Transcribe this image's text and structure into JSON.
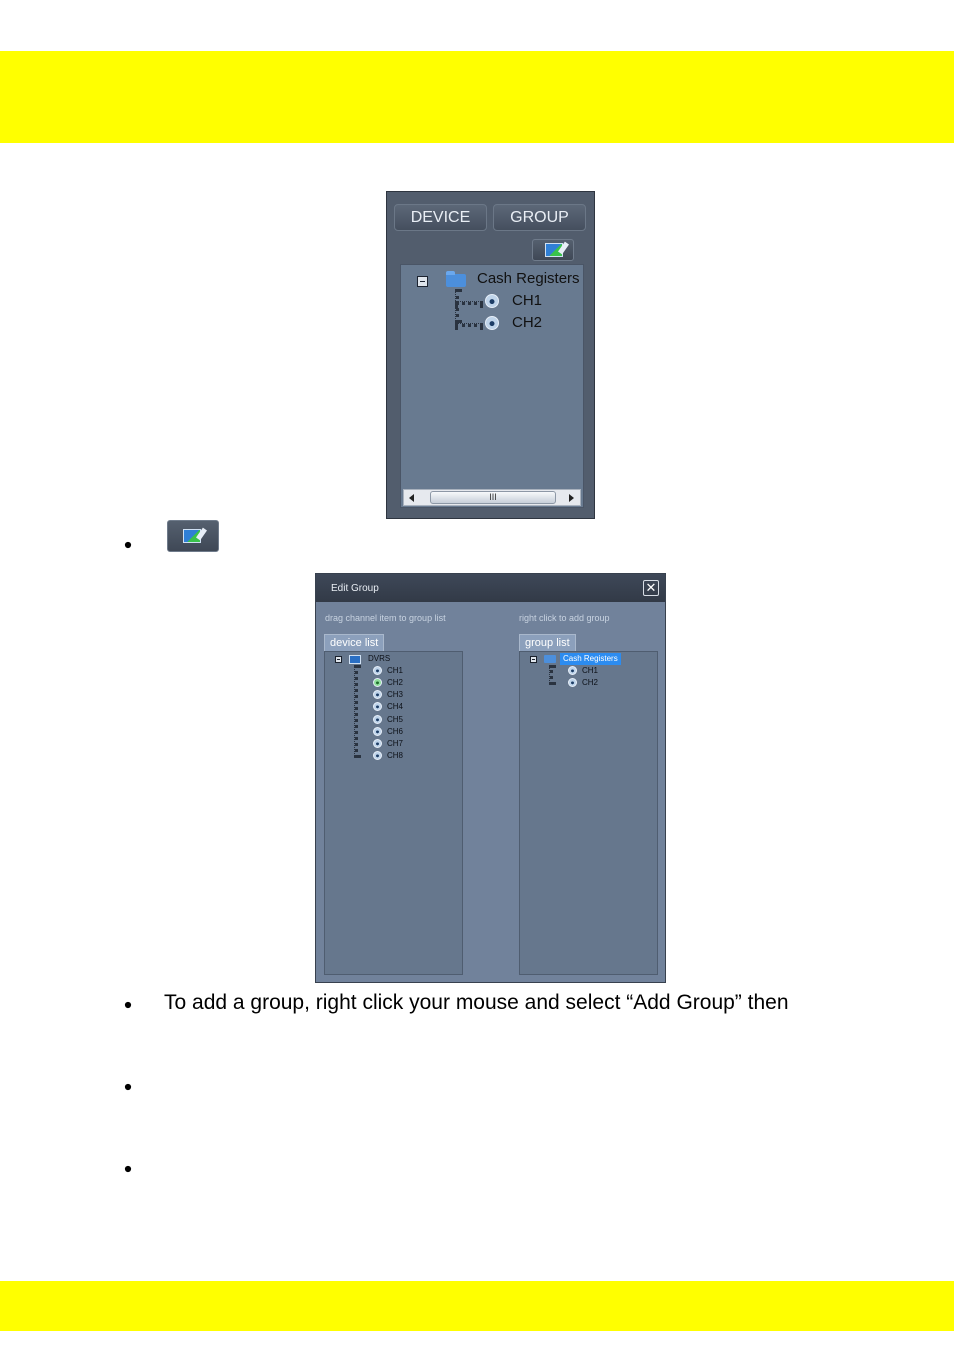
{
  "panel1": {
    "tabs": [
      "DEVICE",
      "GROUP"
    ],
    "edit_button_icon": "edit-group-icon",
    "tree": {
      "group_name": "Cash Registers",
      "channels": [
        "CH1",
        "CH2"
      ]
    },
    "scroll_thumb": "III"
  },
  "dialog": {
    "title": "Edit Group",
    "close_icon": "close-icon",
    "left_hint": "drag channel item to group list",
    "right_hint": "right click to add group",
    "device_list_tab": "device list",
    "group_list_tab": "group list",
    "device_tree": {
      "device_name": "DVRS",
      "channels": [
        "CH1",
        "CH2",
        "CH3",
        "CH4",
        "CH5",
        "CH6",
        "CH7",
        "CH8"
      ]
    },
    "group_tree": {
      "group_name": "Cash Registers",
      "channels": [
        "CH1",
        "CH2"
      ]
    }
  },
  "body_text": {
    "add_group_instruction": "To add a group, right click your mouse and select “Add Group” then"
  },
  "colors": {
    "banner": "#ffff00",
    "panel_bg": "#525d6d",
    "dialog_bg": "#71829b"
  }
}
